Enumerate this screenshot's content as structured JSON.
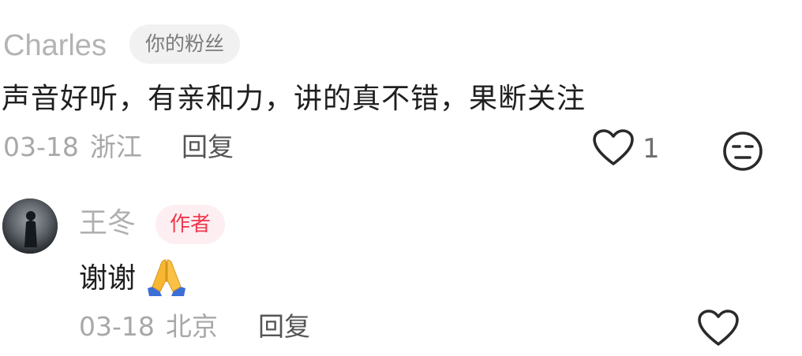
{
  "comment": {
    "author": "Charles",
    "badge": "你的粉丝",
    "text": "声音好听，有亲和力，讲的真不错，果断关注",
    "date": "03-18",
    "location": "浙江",
    "reply_label": "回复",
    "like_count": "1",
    "like_icon": "heart-outline-icon",
    "dislike_icon": "unamused-face-icon"
  },
  "reply": {
    "author": "王冬",
    "badge": "作者",
    "text": "谢谢",
    "emoji_icon": "folded-hands-emoji",
    "date": "03-18",
    "location": "北京",
    "reply_label": "回复",
    "like_icon": "heart-outline-icon"
  },
  "colors": {
    "author_badge_text": "#f0384f",
    "author_badge_bg": "#fdeff1",
    "fan_badge_bg": "#f1f1f1",
    "meta_text": "#a8a8a8"
  }
}
